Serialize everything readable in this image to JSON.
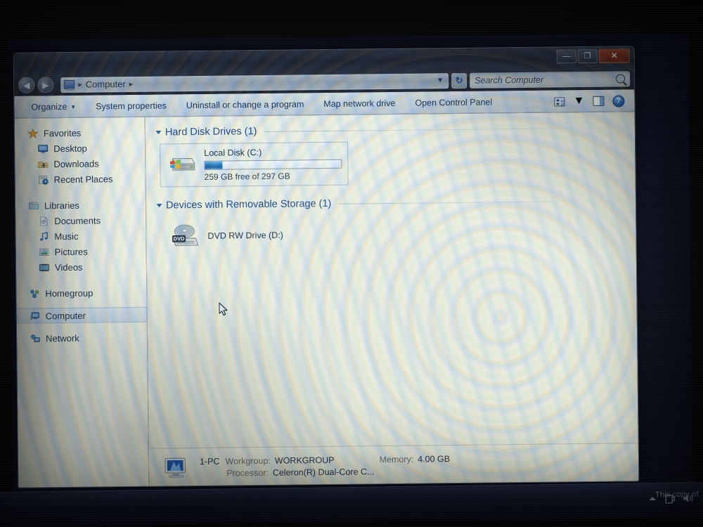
{
  "window": {
    "titlebar": {
      "minimize_label": "—",
      "maximize_label": "❐",
      "close_label": "✕"
    },
    "navigation": {
      "back_label": "◀",
      "forward_label": "▶",
      "address_crumb": "Computer",
      "crumb_sep_left": "▸",
      "crumb_sep_right": "▸",
      "dropdown_label": "▼",
      "refresh_label": "↻"
    },
    "search": {
      "placeholder": "Search Computer"
    },
    "commandbar": {
      "organize": "Organize",
      "organize_caret": "▼",
      "system_properties": "System properties",
      "uninstall": "Uninstall or change a program",
      "map_network_drive": "Map network drive",
      "open_control_panel": "Open Control Panel",
      "view_caret": "▼",
      "help_label": "?"
    }
  },
  "sidebar": {
    "groups": [
      {
        "header": "Favorites",
        "items": [
          "Desktop",
          "Downloads",
          "Recent Places"
        ]
      },
      {
        "header": "Libraries",
        "items": [
          "Documents",
          "Music",
          "Pictures",
          "Videos"
        ]
      }
    ],
    "homegroup": "Homegroup",
    "computer": "Computer",
    "network": "Network"
  },
  "main": {
    "groups": [
      {
        "title": "Hard Disk Drives (1)",
        "drives": [
          {
            "name": "Local Disk (C:)",
            "capacity_text": "259 GB free of 297 GB",
            "free_gb": 259,
            "total_gb": 297,
            "used_percent": 13,
            "bar_color": "#2a86d8",
            "has_bar": true
          }
        ]
      },
      {
        "title": "Devices with Removable Storage (1)",
        "drives": [
          {
            "name": "DVD RW Drive (D:)",
            "capacity_text": "",
            "has_bar": false,
            "badge": "DVD"
          }
        ]
      }
    ]
  },
  "statusbar": {
    "computer_name": "1-PC",
    "workgroup_key": "Workgroup:",
    "workgroup_value": "WORKGROUP",
    "memory_key": "Memory:",
    "memory_value": "4.00 GB",
    "processor_key": "Processor:",
    "processor_value": "Celeron(R) Dual-Core C..."
  },
  "desktop": {
    "watermark": "This copy of"
  }
}
